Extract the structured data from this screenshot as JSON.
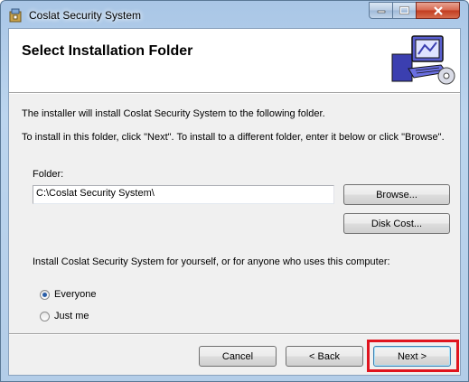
{
  "window": {
    "title": "Coslat Security System",
    "icon": "installer-icon",
    "controls": [
      "minimize-icon",
      "maximize-icon",
      "close-icon"
    ]
  },
  "banner": {
    "title": "Select Installation Folder",
    "art": "computer-with-disc-icon"
  },
  "body": {
    "line1": "The installer will install Coslat Security System to the following folder.",
    "line2": "To install in this folder, click \"Next\". To install to a different folder, enter it below or click \"Browse\".",
    "folder_label": "Folder:",
    "folder_value": "C:\\Coslat Security System\\",
    "browse_label": "Browse...",
    "disk_cost_label": "Disk Cost...",
    "install_for_text": "Install Coslat Security System for yourself, or for anyone who uses this computer:",
    "options": [
      {
        "label": "Everyone",
        "selected": true
      },
      {
        "label": "Just me",
        "selected": false
      }
    ]
  },
  "footer": {
    "cancel_label": "Cancel",
    "back_label": "< Back",
    "next_label": "Next >"
  },
  "colors": {
    "highlight": "#e0141e",
    "close_button": "#c13b1f"
  }
}
